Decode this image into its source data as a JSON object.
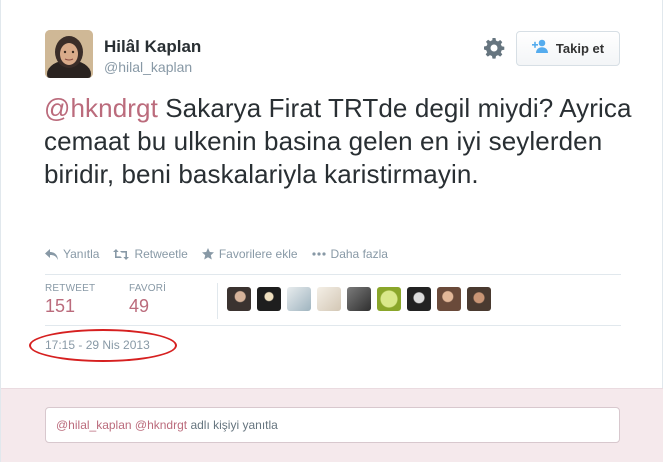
{
  "profile": {
    "fullname": "Hilâl Kaplan",
    "username": "@hilal_kaplan"
  },
  "follow_button": {
    "label": "Takip et"
  },
  "tweet": {
    "mention": "@hkndrgt",
    "text": " Sakarya Firat TRTde degil miydi? Ayrica cemaat bu ulkenin basina gelen en iyi seylerden biridir, beni baskalariyla karistirmayin."
  },
  "actions": {
    "reply": "Yanıtla",
    "retweet": "Retweetle",
    "favorite": "Favorilere ekle",
    "more": "Daha fazla"
  },
  "stats": {
    "retweet_label": "RETWEET",
    "retweet_count": "151",
    "favorite_label": "FAVORİ",
    "favorite_count": "49"
  },
  "timestamp": "17:15 - 29 Nis 2013",
  "reply": {
    "mention1": "@hilal_kaplan",
    "mention2": "@hkndrgt",
    "suffix": " adlı kişiyi yanıtla"
  },
  "colors": {
    "accent": "#bb6b7c",
    "muted": "#8899a6",
    "annotation": "#d62020"
  },
  "icons": [
    "gear-icon",
    "follow-person-icon",
    "reply-icon",
    "retweet-icon",
    "star-icon",
    "more-icon"
  ]
}
